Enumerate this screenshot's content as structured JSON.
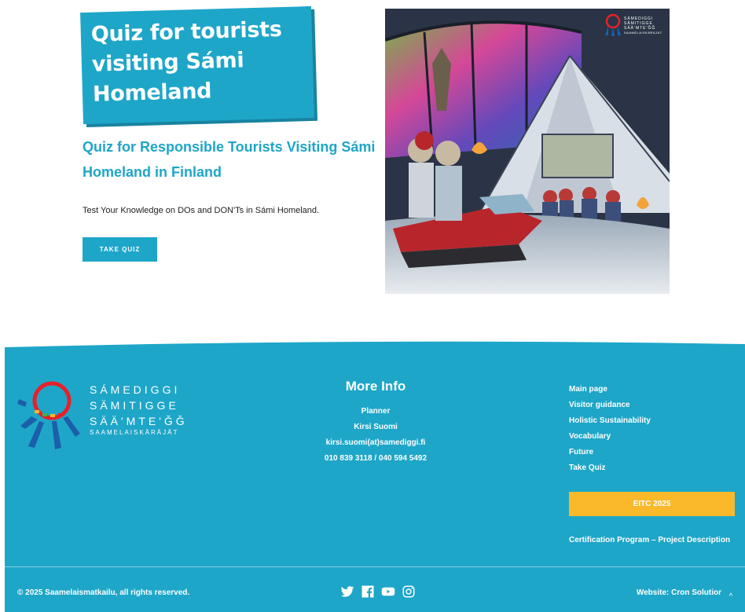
{
  "hero": {
    "banner_title": "Quiz for tourists visiting Sámi Homeland",
    "subtitle": "Quiz for Responsible Tourists Visiting Sámi Homeland in Finland",
    "lead": "Test Your Knowledge on DOs and DON'Ts in Sámi Homeland.",
    "take_quiz_label": "TAKE QUIZ"
  },
  "illustration": {
    "logo_lines": [
      "SÁMEDIGGI",
      "SÄMITIGGE",
      "SÄÄ'MTE'ǦǦ",
      "SAAMELAISKÄRÄJÄT"
    ]
  },
  "footer": {
    "logo": {
      "line1": "SÁMEDIGGI",
      "line2": "SÄMITIGGE",
      "line3": "SÄÄ'MTE'ǦǦ",
      "line4": "SAAMELAISKÄRÄJÄT",
      "colors": [
        "#e8202a",
        "#1b5faa",
        "#f9b92b",
        "#3bb54a"
      ]
    },
    "more_info": {
      "heading": "More Info",
      "role": "Planner",
      "name": "Kirsi Suomi",
      "email": "kirsi.suomi(at)samediggi.fi",
      "phone": "010 839 3118 / 040 594 5492"
    },
    "nav": [
      "Main page",
      "Visitor guidance",
      "Holistic Sustainability",
      "Vocabulary",
      "Future",
      "Take Quiz"
    ],
    "eitc_label": "EITC 2025",
    "cert_link": "Certification Program – Project Description",
    "copyright": "© 2025 Saamelaismatkailu, all rights reserved.",
    "socials": [
      "twitter-icon",
      "facebook-icon",
      "youtube-icon",
      "instagram-icon"
    ],
    "website": "Website: Cron Solutior",
    "scroll_top": "^"
  },
  "colors": {
    "accent": "#1ea6c8",
    "button_yellow": "#f9b92b"
  }
}
